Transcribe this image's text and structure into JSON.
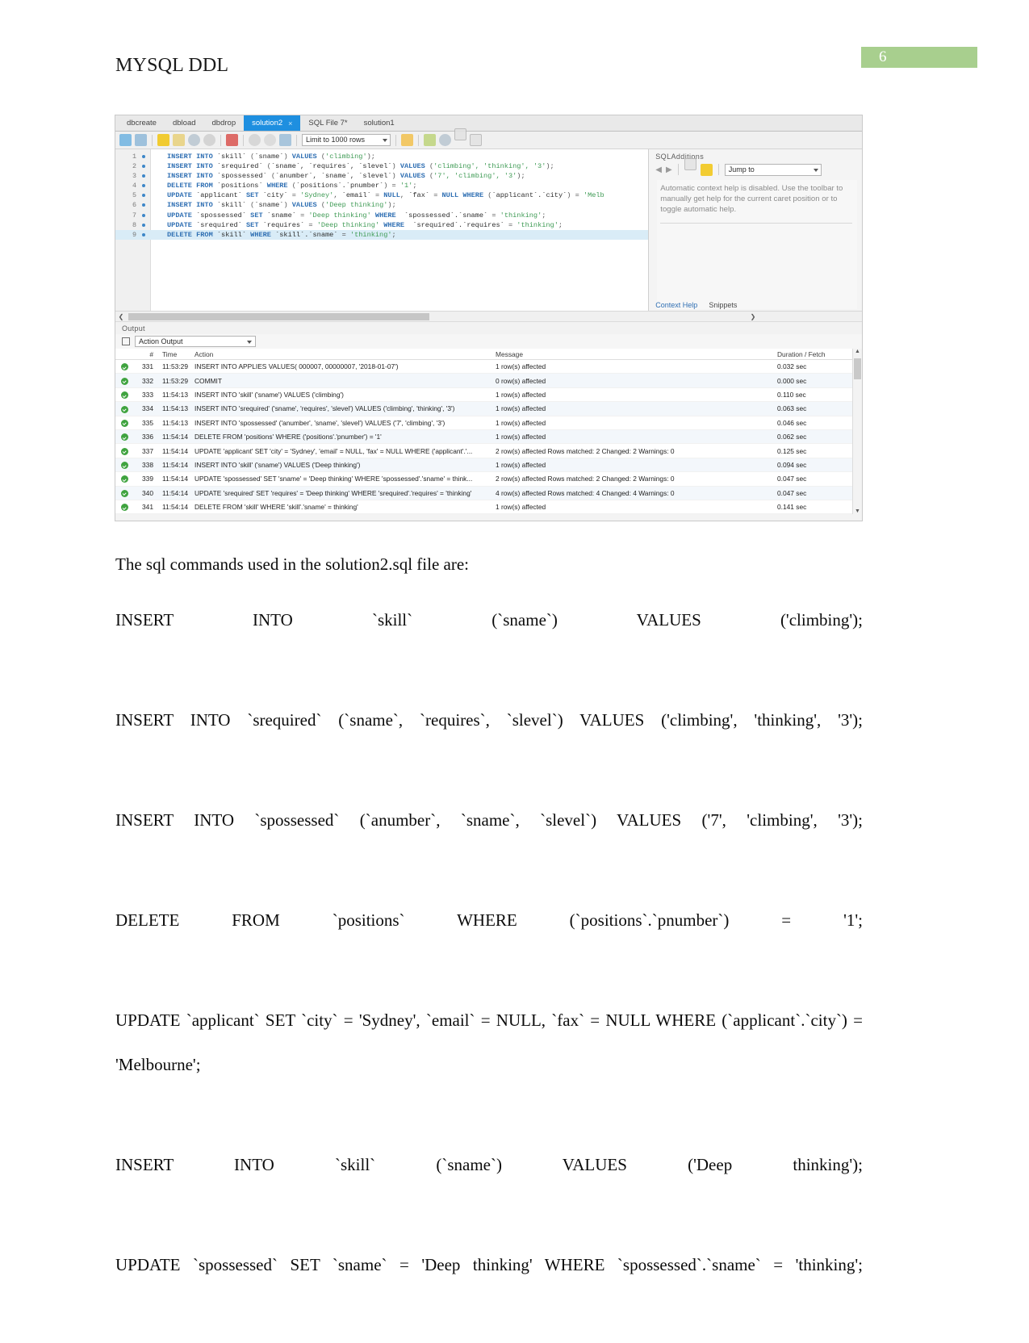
{
  "document": {
    "header_title": "MYSQL DDL",
    "page_number": "6",
    "page_badge_color": "#a8cf8e",
    "intro": "The sql commands used in the solution2.sql file are:",
    "commands": [
      "INSERT INTO `skill` (`sname`) VALUES ('climbing');",
      "INSERT INTO `srequired` (`sname`, `requires`, `slevel`) VALUES ('climbing', 'thinking', '3');",
      "INSERT INTO `spossessed` (`anumber`, `sname`, `slevel`) VALUES ('7', 'climbing', '3');",
      "DELETE FROM `positions` WHERE (`positions`.`pnumber`) = '1';",
      "UPDATE `applicant` SET `city` = 'Sydney', `email` = NULL, `fax` = NULL WHERE (`applicant`.`city`) = 'Melbourne';",
      "INSERT INTO `skill` (`sname`) VALUES ('Deep thinking');",
      "UPDATE `spossessed` SET `sname` = 'Deep thinking' WHERE  `spossessed`.`sname` = 'thinking';"
    ]
  },
  "workbench": {
    "tabs": [
      {
        "label": "dbcreate",
        "active": false,
        "closable": false
      },
      {
        "label": "dbload",
        "active": false,
        "closable": false
      },
      {
        "label": "dbdrop",
        "active": false,
        "closable": false
      },
      {
        "label": "solution2",
        "active": true,
        "closable": true,
        "close_glyph": "×"
      },
      {
        "label": "SQL File 7*",
        "active": false,
        "closable": false
      },
      {
        "label": "solution1",
        "active": false,
        "closable": false
      }
    ],
    "toolbar": {
      "limit_select": "Limit to 1000 rows",
      "icons": [
        "open-folder-icon",
        "save-icon",
        "execute-bolt-icon",
        "execute-current-bolt-icon",
        "explain-magnifier-icon",
        "stop-icon",
        "toggle-record-icon",
        "commit-icon",
        "rollback-icon",
        "autocommit-icon",
        "beautify-star-icon",
        "clear-brush-icon",
        "find-magnifier-icon",
        "invisible-chars-icon",
        "wrap-lines-icon"
      ]
    },
    "editor": {
      "lines": [
        {
          "n": "1",
          "selected": false,
          "tokens": [
            {
              "t": "INSERT INTO ",
              "c": "kw"
            },
            {
              "t": "`skill` ",
              "c": "id"
            },
            {
              "t": "(",
              "c": "op"
            },
            {
              "t": "`sname`",
              "c": "id"
            },
            {
              "t": ") ",
              "c": "op"
            },
            {
              "t": "VALUES ",
              "c": "kw"
            },
            {
              "t": "(",
              "c": "op"
            },
            {
              "t": "'climbing'",
              "c": "str"
            },
            {
              "t": ");",
              "c": "op"
            }
          ]
        },
        {
          "n": "2",
          "selected": false,
          "tokens": [
            {
              "t": "INSERT INTO ",
              "c": "kw"
            },
            {
              "t": "`srequired` ",
              "c": "id"
            },
            {
              "t": "(",
              "c": "op"
            },
            {
              "t": "`sname`, `requires`, `slevel`",
              "c": "id"
            },
            {
              "t": ") ",
              "c": "op"
            },
            {
              "t": "VALUES ",
              "c": "kw"
            },
            {
              "t": "(",
              "c": "op"
            },
            {
              "t": "'climbing', 'thinking', '3'",
              "c": "str"
            },
            {
              "t": ");",
              "c": "op"
            }
          ]
        },
        {
          "n": "3",
          "selected": false,
          "tokens": [
            {
              "t": "INSERT INTO ",
              "c": "kw"
            },
            {
              "t": "`spossessed` ",
              "c": "id"
            },
            {
              "t": "(",
              "c": "op"
            },
            {
              "t": "`anumber`, `sname`, `slevel`",
              "c": "id"
            },
            {
              "t": ") ",
              "c": "op"
            },
            {
              "t": "VALUES ",
              "c": "kw"
            },
            {
              "t": "(",
              "c": "op"
            },
            {
              "t": "'7', 'climbing', '3'",
              "c": "str"
            },
            {
              "t": ");",
              "c": "op"
            }
          ]
        },
        {
          "n": "4",
          "selected": false,
          "tokens": [
            {
              "t": "DELETE FROM ",
              "c": "kw"
            },
            {
              "t": "`positions` ",
              "c": "id"
            },
            {
              "t": "WHERE ",
              "c": "kw"
            },
            {
              "t": "(",
              "c": "op"
            },
            {
              "t": "`positions`.`pnumber`",
              "c": "id"
            },
            {
              "t": ") = ",
              "c": "op"
            },
            {
              "t": "'1'",
              "c": "str"
            },
            {
              "t": ";",
              "c": "op"
            }
          ]
        },
        {
          "n": "5",
          "selected": false,
          "tokens": [
            {
              "t": "UPDATE ",
              "c": "kw"
            },
            {
              "t": "`applicant` ",
              "c": "id"
            },
            {
              "t": "SET ",
              "c": "kw"
            },
            {
              "t": "`city` ",
              "c": "id"
            },
            {
              "t": "= ",
              "c": "op"
            },
            {
              "t": "'Sydney'",
              "c": "str"
            },
            {
              "t": ", ",
              "c": "op"
            },
            {
              "t": "`email` ",
              "c": "id"
            },
            {
              "t": "= ",
              "c": "op"
            },
            {
              "t": "NULL",
              "c": "kw"
            },
            {
              "t": ", ",
              "c": "op"
            },
            {
              "t": "`fax` ",
              "c": "id"
            },
            {
              "t": "= ",
              "c": "op"
            },
            {
              "t": "NULL ",
              "c": "kw"
            },
            {
              "t": "WHERE ",
              "c": "kw"
            },
            {
              "t": "(",
              "c": "op"
            },
            {
              "t": "`applicant`.`city`",
              "c": "id"
            },
            {
              "t": ") = ",
              "c": "op"
            },
            {
              "t": "'Melb",
              "c": "str"
            }
          ]
        },
        {
          "n": "6",
          "selected": false,
          "tokens": [
            {
              "t": "INSERT INTO ",
              "c": "kw"
            },
            {
              "t": "`skill` ",
              "c": "id"
            },
            {
              "t": "(",
              "c": "op"
            },
            {
              "t": "`sname`",
              "c": "id"
            },
            {
              "t": ") ",
              "c": "op"
            },
            {
              "t": "VALUES ",
              "c": "kw"
            },
            {
              "t": "(",
              "c": "op"
            },
            {
              "t": "'Deep thinking'",
              "c": "str"
            },
            {
              "t": ");",
              "c": "op"
            }
          ]
        },
        {
          "n": "7",
          "selected": false,
          "tokens": [
            {
              "t": "UPDATE ",
              "c": "kw"
            },
            {
              "t": "`spossessed` ",
              "c": "id"
            },
            {
              "t": "SET ",
              "c": "kw"
            },
            {
              "t": "`sname` ",
              "c": "id"
            },
            {
              "t": "= ",
              "c": "op"
            },
            {
              "t": "'Deep thinking' ",
              "c": "str"
            },
            {
              "t": "WHERE ",
              "c": "kw"
            },
            {
              "t": " `spossessed`.`sname` ",
              "c": "id"
            },
            {
              "t": "= ",
              "c": "op"
            },
            {
              "t": "'thinking'",
              "c": "str"
            },
            {
              "t": ";",
              "c": "op"
            }
          ]
        },
        {
          "n": "8",
          "selected": false,
          "tokens": [
            {
              "t": "UPDATE ",
              "c": "kw"
            },
            {
              "t": "`srequired` ",
              "c": "id"
            },
            {
              "t": "SET ",
              "c": "kw"
            },
            {
              "t": "`requires` ",
              "c": "id"
            },
            {
              "t": "= ",
              "c": "op"
            },
            {
              "t": "'Deep thinking' ",
              "c": "str"
            },
            {
              "t": "WHERE ",
              "c": "kw"
            },
            {
              "t": " `srequired`.`requires` ",
              "c": "id"
            },
            {
              "t": "= ",
              "c": "op"
            },
            {
              "t": "'thinking'",
              "c": "str"
            },
            {
              "t": ";",
              "c": "op"
            }
          ]
        },
        {
          "n": "9",
          "selected": true,
          "tokens": [
            {
              "t": "DELETE FROM ",
              "c": "kw"
            },
            {
              "t": "`skill` ",
              "c": "id"
            },
            {
              "t": "WHERE ",
              "c": "kw"
            },
            {
              "t": "`skill`.`sname` ",
              "c": "id"
            },
            {
              "t": "= ",
              "c": "op"
            },
            {
              "t": "'thinking'",
              "c": "str"
            },
            {
              "t": ";",
              "c": "op"
            }
          ]
        }
      ]
    },
    "sql_additions": {
      "title": "SQLAdditions",
      "jump_to": "Jump to",
      "help_text": "Automatic context help is disabled. Use the toolbar to manually get help for the current caret position or to toggle automatic help.",
      "bottom_tabs": [
        "Context Help",
        "Snippets"
      ]
    },
    "output": {
      "section_label": "Output",
      "selector": "Action Output",
      "columns": [
        "#",
        "Time",
        "Action",
        "Message",
        "Duration / Fetch"
      ],
      "rows": [
        {
          "status": "ok",
          "num": "331",
          "time": "11:53:29",
          "action": "INSERT INTO APPLIES VALUES( 000007, 00000007, '2018-01-07')",
          "message": "1 row(s) affected",
          "duration": "0.032 sec"
        },
        {
          "status": "ok",
          "num": "332",
          "time": "11:53:29",
          "action": "COMMIT",
          "message": "0 row(s) affected",
          "duration": "0.000 sec"
        },
        {
          "status": "ok",
          "num": "333",
          "time": "11:54:13",
          "action": "INSERT INTO 'skill' ('sname') VALUES ('climbing')",
          "message": "1 row(s) affected",
          "duration": "0.110 sec"
        },
        {
          "status": "ok",
          "num": "334",
          "time": "11:54:13",
          "action": "INSERT INTO 'srequired' ('sname', 'requires', 'slevel') VALUES ('climbing', 'thinking', '3')",
          "message": "1 row(s) affected",
          "duration": "0.063 sec"
        },
        {
          "status": "ok",
          "num": "335",
          "time": "11:54:13",
          "action": "INSERT INTO 'spossessed' ('anumber', 'sname', 'slevel') VALUES ('7', 'climbing', '3')",
          "message": "1 row(s) affected",
          "duration": "0.046 sec"
        },
        {
          "status": "ok",
          "num": "336",
          "time": "11:54:14",
          "action": "DELETE FROM 'positions' WHERE ('positions'.'pnumber') = '1'",
          "message": "1 row(s) affected",
          "duration": "0.062 sec"
        },
        {
          "status": "ok",
          "num": "337",
          "time": "11:54:14",
          "action": "UPDATE 'applicant' SET 'city' = 'Sydney', 'email' = NULL, 'fax' = NULL WHERE ('applicant'.'...",
          "message": "2 row(s) affected Rows matched: 2  Changed: 2  Warnings: 0",
          "duration": "0.125 sec"
        },
        {
          "status": "ok",
          "num": "338",
          "time": "11:54:14",
          "action": "INSERT INTO 'skill' ('sname') VALUES ('Deep thinking')",
          "message": "1 row(s) affected",
          "duration": "0.094 sec"
        },
        {
          "status": "ok",
          "num": "339",
          "time": "11:54:14",
          "action": "UPDATE 'spossessed' SET 'sname' = 'Deep thinking' WHERE  'spossessed'.'sname' = think...",
          "message": "2 row(s) affected Rows matched: 2  Changed: 2  Warnings: 0",
          "duration": "0.047 sec"
        },
        {
          "status": "ok",
          "num": "340",
          "time": "11:54:14",
          "action": "UPDATE 'srequired' SET 'requires' = 'Deep thinking' WHERE  'srequired'.'requires' = 'thinking'",
          "message": "4 row(s) affected Rows matched: 4  Changed: 4  Warnings: 0",
          "duration": "0.047 sec"
        },
        {
          "status": "ok",
          "num": "341",
          "time": "11:54:14",
          "action": "DELETE FROM 'skill' WHERE 'skill'.'sname' = thinking'",
          "message": "1 row(s) affected",
          "duration": "0.141 sec"
        }
      ]
    }
  }
}
